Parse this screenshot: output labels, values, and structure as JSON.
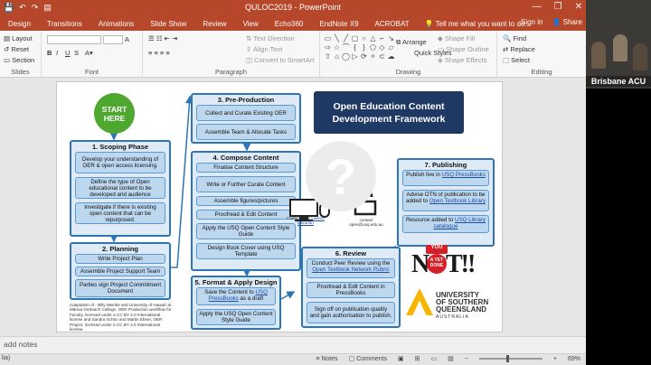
{
  "window": {
    "title": "QULOC2019 - PowerPoint",
    "controls": [
      "—",
      "❐",
      "✕"
    ]
  },
  "qat": [
    "💾",
    "↶",
    "↷",
    "▤"
  ],
  "tabs": [
    "Design",
    "Transitions",
    "Animations",
    "Slide Show",
    "Review",
    "View",
    "Echo360",
    "EndNote X9",
    "ACROBAT"
  ],
  "tell_me": "Tell me what you want to do...",
  "account": {
    "sign_in": "Sign in",
    "share": "Share"
  },
  "ribbon": {
    "slides_group": {
      "label": "Slides",
      "items": [
        "Layout",
        "Reset",
        "Section"
      ]
    },
    "font_group": {
      "label": "Font"
    },
    "paragraph_group": {
      "label": "Paragraph",
      "items": [
        "Text Direction",
        "Align Text",
        "Convert to SmartArt"
      ]
    },
    "drawing_group": {
      "label": "Drawing",
      "items": [
        "Arrange",
        "Quick Styles",
        "Shape Fill",
        "Shape Outline",
        "Shape Effects"
      ]
    },
    "editing_group": {
      "label": "Editing",
      "items": [
        "Find",
        "Replace",
        "Select"
      ]
    }
  },
  "video": {
    "label": "Brisbane ACU"
  },
  "slide": {
    "start": "START HERE",
    "framework_title": "Open Education Content Development Framework",
    "phase1": {
      "title": "1. Scoping Phase",
      "items": [
        "Develop your understanding of OER & open access licensing.",
        "Define the type of Open educational content to be developed and audience",
        "Investigate if there is existing open content that can be repurposed."
      ]
    },
    "phase2": {
      "title": "2. Planning",
      "items": [
        "Write Project Plan",
        "Assemble Project Support Team",
        "Parties sign Project Commitment Document"
      ]
    },
    "phase3": {
      "title": "3. Pre-Production",
      "items": [
        "Collect and Curate Existing OER",
        "Assemble Team & Allocate Tasks"
      ]
    },
    "phase4": {
      "title": "4. Compose Content",
      "items": [
        "Finalise Content Structure",
        "Write or Further Curate Content",
        "Assemble figures/pictures",
        "Proofread & Edit Content",
        "Apply the USQ Open Content Style Guide",
        "Design Book Cover using USQ Template"
      ]
    },
    "phase5": {
      "title": "5. Format & Apply Design",
      "item1_pre": "Save the Content to ",
      "item1_link": "USQ PressBooks",
      "item1_post": " as a draft",
      "item2": "Apply the USQ Open Content Style Guide"
    },
    "phase6": {
      "title": "6. Review",
      "item1_pre": "Conduct Peer Review using the ",
      "item1_link": "Open Textbook Network Rubric",
      "item2": "Proofread & Edit Content in PressBooks",
      "item3": "Sign off on publication quality and gain authorisation to publish."
    },
    "phase7": {
      "title": "7. Publishing",
      "item1_pre": "Publish live in ",
      "item1_link": "USQ PressBooks",
      "item2_pre": "Advise OTN of publication to be added to ",
      "item2_link": "Open Textbook Library",
      "item3_pre": "Resource added to ",
      "item3_link": "USQ Library catalogue"
    },
    "contact_left": {
      "title": "Contact your",
      "link": "Liaison Librarian"
    },
    "contact_right": {
      "title": "contact",
      "email": "open@usq.edu.au"
    },
    "adaptation_note": "Adaptation of - Billy Meinke and University of Hawai'i at Mānoa Outreach College, OER Production workflow for Faculty, licensed under a CC BY 4.0 International license and Sandra Schön and Martin Ebner, OER Project, licensed under a CC BY 4.0 International license.",
    "notyet": {
      "you": "YOU",
      "word": "NOT!!",
      "seal": "A YET DONE"
    },
    "usq": {
      "line1": "UNIVERSITY",
      "line2": "OF SOUTHERN",
      "line3": "QUEENSLAND",
      "line4": "AUSTRALIA"
    }
  },
  "status": {
    "notes_hint": "add notes",
    "left_text": "lia)",
    "notes_btn": "Notes",
    "comments_btn": "Comments",
    "zoom": "69%"
  },
  "colors": {
    "accent": "#b7472a",
    "box_border": "#2e75b6",
    "box_fill": "#deebf7",
    "start_green": "#4ea72e",
    "framework_navy": "#1f3864",
    "usq_gold": "#f7b500"
  }
}
